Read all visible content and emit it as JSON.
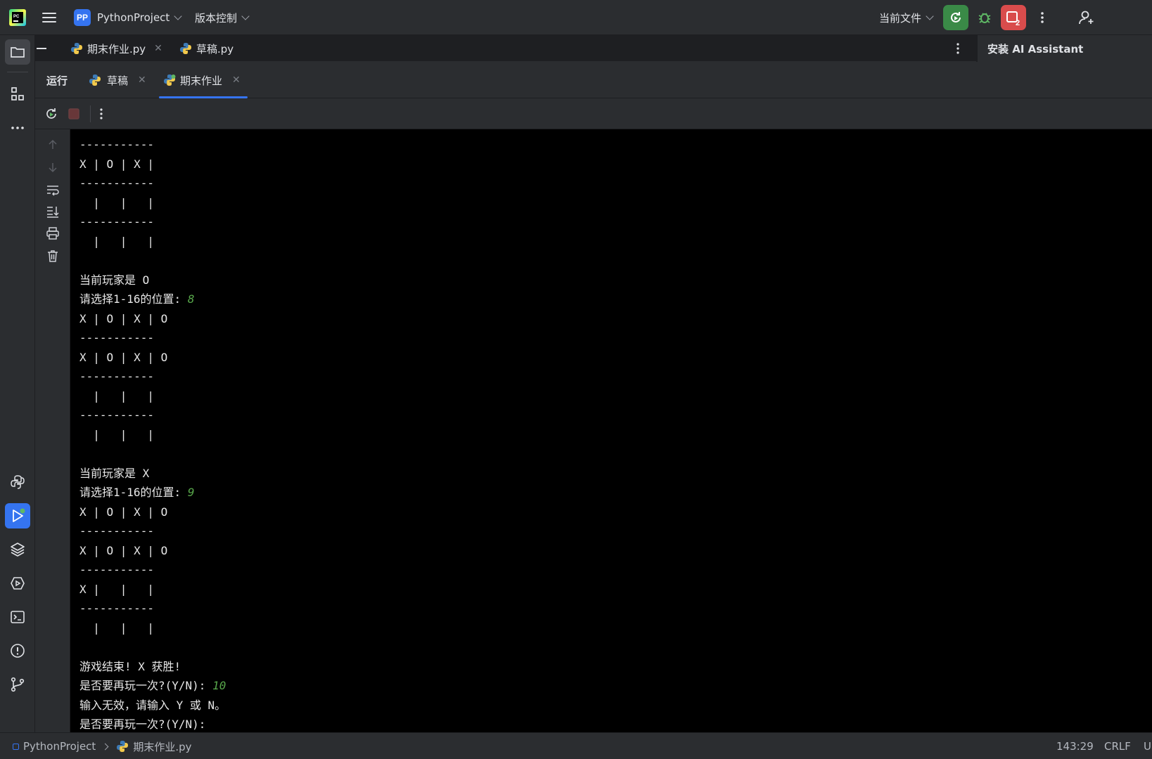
{
  "titlebar": {
    "project_badge": "PP",
    "project_name": "PythonProject",
    "vcs_label": "版本控制",
    "run_config": "当前文件"
  },
  "editor_tabs": [
    {
      "label": "期末作业.py"
    },
    {
      "label": "草稿.py"
    }
  ],
  "right_panel": {
    "title": "安装 AI Assistant"
  },
  "run_panel": {
    "title": "运行",
    "tabs": [
      {
        "label": "草稿",
        "active": false
      },
      {
        "label": "期末作业",
        "active": true
      }
    ]
  },
  "console": {
    "lines": [
      {
        "text": "-----------"
      },
      {
        "text": "X | O | X |"
      },
      {
        "text": "-----------"
      },
      {
        "text": "  |   |   |"
      },
      {
        "text": "-----------"
      },
      {
        "text": "  |   |   |"
      },
      {
        "text": ""
      },
      {
        "text": "当前玩家是 O"
      },
      {
        "text": "请选择1-16的位置: ",
        "input": "8"
      },
      {
        "text": "X | O | X | O"
      },
      {
        "text": "-----------"
      },
      {
        "text": "X | O | X | O"
      },
      {
        "text": "-----------"
      },
      {
        "text": "  |   |   |"
      },
      {
        "text": "-----------"
      },
      {
        "text": "  |   |   |"
      },
      {
        "text": ""
      },
      {
        "text": "当前玩家是 X"
      },
      {
        "text": "请选择1-16的位置: ",
        "input": "9"
      },
      {
        "text": "X | O | X | O"
      },
      {
        "text": "-----------"
      },
      {
        "text": "X | O | X | O"
      },
      {
        "text": "-----------"
      },
      {
        "text": "X |   |   |"
      },
      {
        "text": "-----------"
      },
      {
        "text": "  |   |   |"
      },
      {
        "text": ""
      },
      {
        "text": "游戏结束! X 获胜!"
      },
      {
        "text": "是否要再玩一次?(Y/N): ",
        "input": "10"
      },
      {
        "text": "输入无效，请输入 Y 或 N。"
      },
      {
        "text": "是否要再玩一次?(Y/N): "
      }
    ]
  },
  "statusbar": {
    "project": "PythonProject",
    "file": "期末作业.py",
    "position": "143:29",
    "line_ending": "CRLF",
    "encoding": "U"
  },
  "badges": {
    "run_notifications": "2"
  },
  "colors": {
    "accent": "#3574f0",
    "run_green": "#3a8a47",
    "stop_red": "#d94c4c",
    "console_input": "#57a64a"
  },
  "icons": [
    "pycharm-logo-icon",
    "hamburger-menu-icon",
    "rerun-icon",
    "debug-bug-icon",
    "stop-icon",
    "more-vertical-icon",
    "add-user-icon",
    "folder-icon",
    "structure-icon",
    "more-horizontal-icon",
    "python-console-icon",
    "run-icon",
    "layers-icon",
    "services-icon",
    "terminal-icon",
    "problems-icon",
    "git-icon",
    "arrow-up-icon",
    "arrow-down-icon",
    "soft-wrap-icon",
    "scroll-to-end-icon",
    "print-icon",
    "trash-icon",
    "python-file-icon",
    "close-icon",
    "chevron-right-icon"
  ]
}
